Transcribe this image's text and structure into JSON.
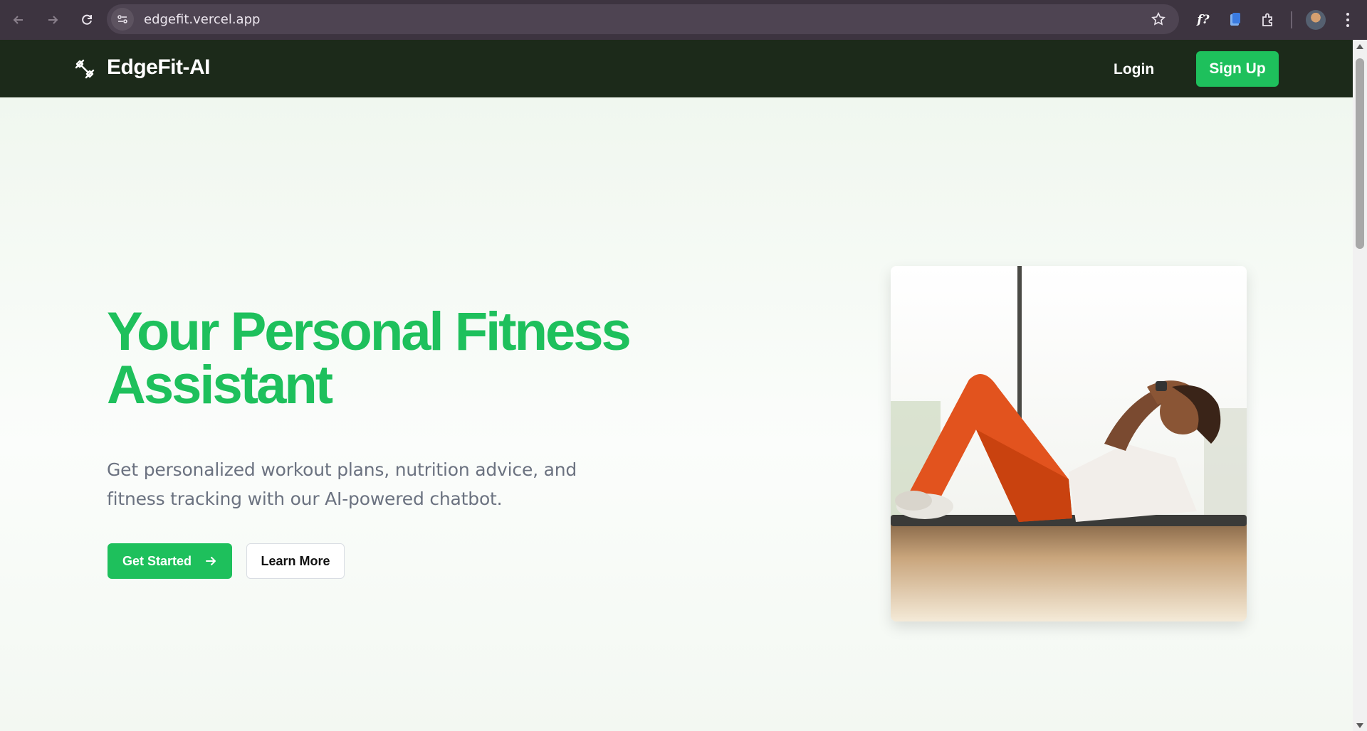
{
  "browser": {
    "url": "edgefit.vercel.app",
    "icons": [
      "back-icon",
      "forward-icon",
      "reload-icon",
      "site-info-icon",
      "bookmark-star-icon",
      "extension-icon",
      "puzzle-icon",
      "profile-avatar",
      "more-icon"
    ]
  },
  "header": {
    "brand": "EdgeFit-AI",
    "logo_icon": "dumbbell-icon",
    "login_label": "Login",
    "signup_label": "Sign Up"
  },
  "hero": {
    "headline_line1": "Your Personal Fitness",
    "headline_line2": "Assistant",
    "subtext": "Get personalized workout plans, nutrition advice, and fitness tracking with our AI-powered chatbot.",
    "primary_button": "Get Started",
    "primary_button_icon": "arrow-right-icon",
    "secondary_button": "Learn More"
  },
  "colors": {
    "accent": "#1ec05c",
    "header_bg": "#1c2a1a",
    "browser_bg": "#3d3440",
    "muted_text": "#6b7280"
  }
}
